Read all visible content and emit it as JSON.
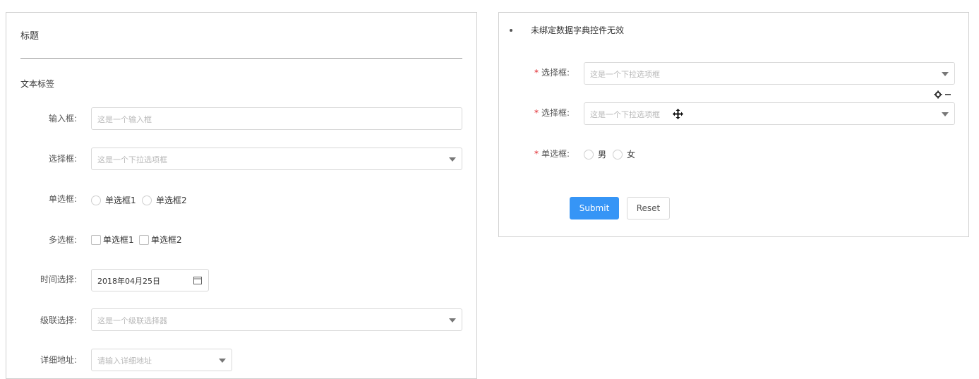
{
  "left_form": {
    "title": "标题",
    "section_label": "文本标签",
    "input_row": {
      "label": "输入框:",
      "placeholder": "这是一个输入框"
    },
    "select_row": {
      "label": "选择框:",
      "placeholder": "这是一个下拉选项框"
    },
    "radio_row": {
      "label": "单选框:",
      "options": [
        "单选框1",
        "单选框2"
      ]
    },
    "checkbox_row": {
      "label": "多选框:",
      "options": [
        "单选框1",
        "单选框2"
      ]
    },
    "date_row": {
      "label": "时间选择:",
      "value": "2018年04月25日",
      "icon": "calendar-icon"
    },
    "cascader_row": {
      "label": "级联选择:",
      "placeholder": "这是一个级联选择器"
    },
    "address_row": {
      "label": "详细地址:",
      "placeholder": "请输入详细地址"
    }
  },
  "right_form": {
    "notice": "未绑定数据字典控件无效",
    "select_row_1": {
      "label": "选择框:",
      "placeholder": "这是一个下拉选项框",
      "required": "*"
    },
    "select_row_2": {
      "label": "选择框:",
      "placeholder": "这是一个下拉选项框",
      "required": "*"
    },
    "tools": {
      "settings_icon": "gear-icon",
      "remove_icon": "minus-icon",
      "move_icon": "move-cursor-icon"
    },
    "gender_row": {
      "label": "单选框:",
      "options": [
        "男",
        "女"
      ],
      "required": "*"
    },
    "buttons": {
      "submit": "Submit",
      "reset": "Reset"
    }
  },
  "colors": {
    "primary": "#3695f6",
    "required": "#e0262d",
    "border": "#d9d9d9",
    "placeholder": "#b9b9b9"
  }
}
